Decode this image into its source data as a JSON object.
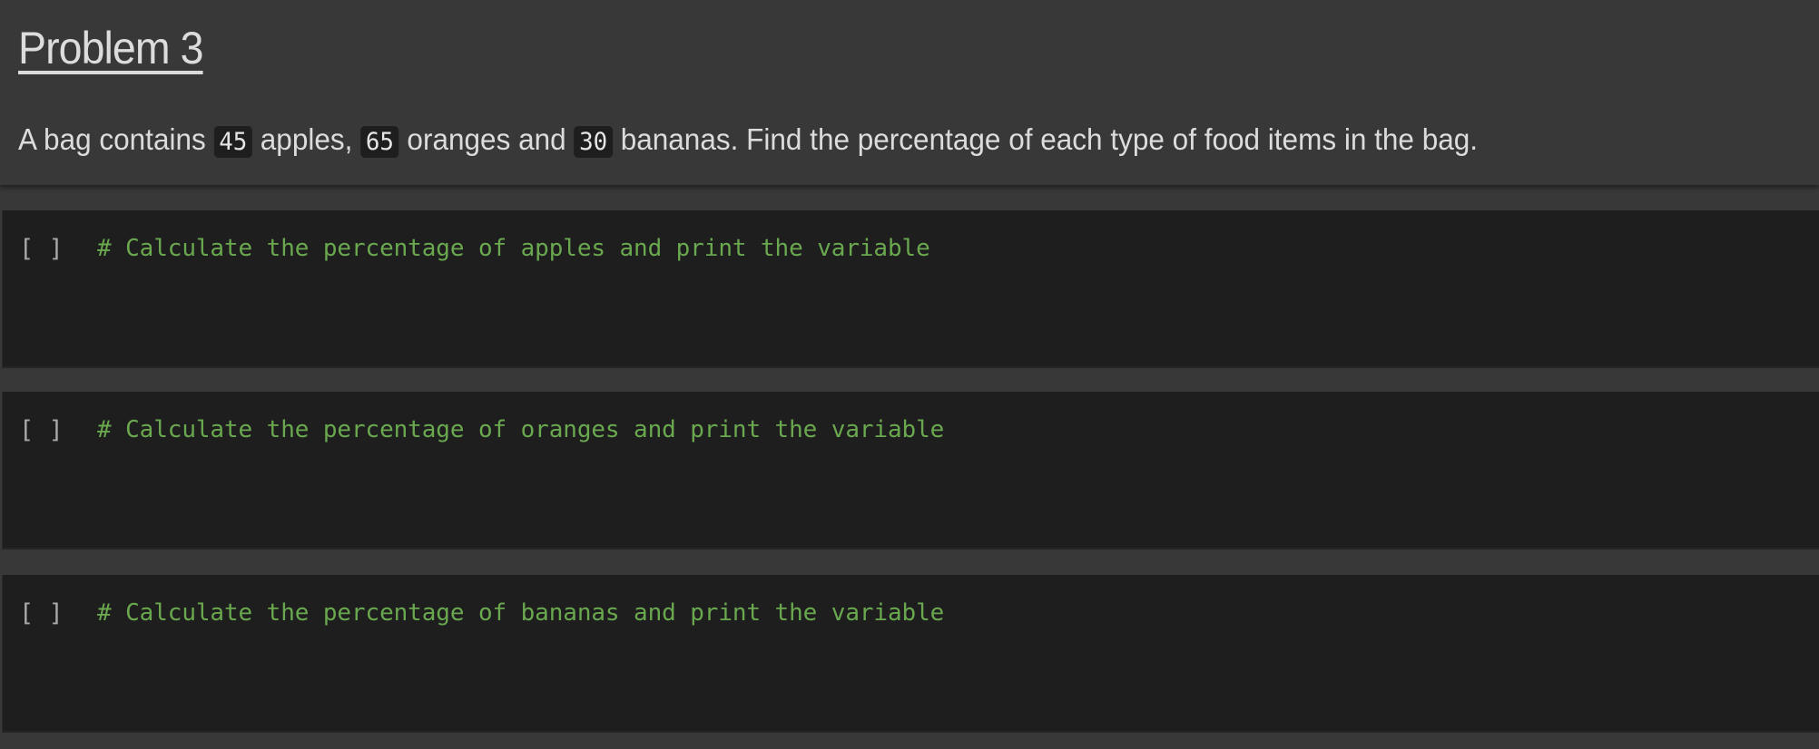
{
  "markdown": {
    "title": "Problem 3",
    "paragraph": {
      "before_apples": "A bag contains ",
      "apples_count": "45",
      "after_apples": " apples, ",
      "oranges_count": "65",
      "after_oranges": " oranges and ",
      "bananas_count": "30",
      "after_bananas": " bananas. Find the percentage of each type of food items in the bag."
    }
  },
  "code_cells": [
    {
      "run_indicator": "[ ]",
      "code": "# Calculate the percentage of apples and print the variable"
    },
    {
      "run_indicator": "[ ]",
      "code": "# Calculate the percentage of oranges and print the variable"
    },
    {
      "run_indicator": "[ ]",
      "code": "# Calculate the percentage of bananas and print the variable"
    }
  ],
  "colors": {
    "background": "#383838",
    "code_background": "#1e1e1e",
    "comment": "#6aa84f",
    "text": "#dcdcdc"
  }
}
